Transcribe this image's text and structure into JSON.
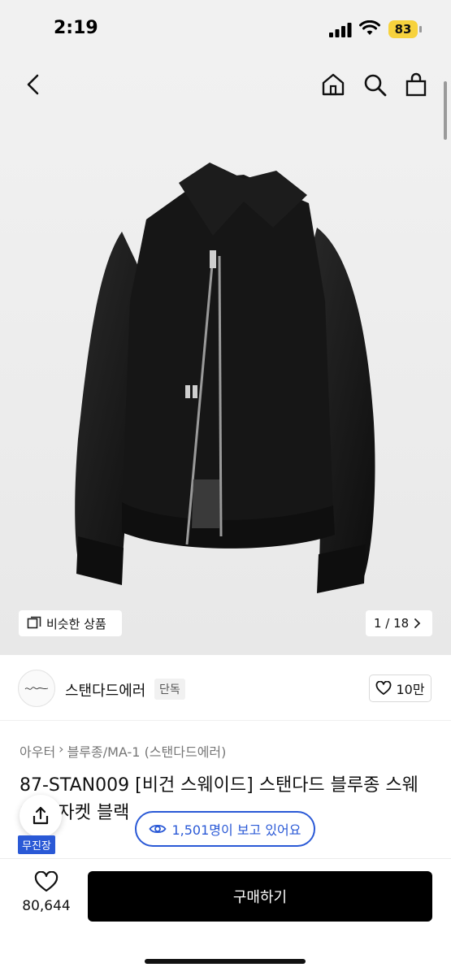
{
  "status_bar": {
    "time": "2:19",
    "battery": "83"
  },
  "gallery": {
    "similar_label": "비슷한 상품",
    "counter": "1 / 18"
  },
  "brand": {
    "name": "스탠다드에러",
    "tag": "단독",
    "likes": "10만"
  },
  "breadcrumb": [
    "아우터",
    "블루종/MA-1 (스탠다드에러)"
  ],
  "product": {
    "title": "87-STAN009 [비건 스웨이드] 스탠다드 블루종 스웨이드 자켓 블랙",
    "badge": "무진장"
  },
  "viewers": "1,501명이 보고 있어요",
  "bottom": {
    "like_count": "80,644",
    "buy_label": "구매하기"
  },
  "colors": {
    "accent": "#2a59d6",
    "buy_button": "#000000",
    "battery": "#f7d23d"
  }
}
